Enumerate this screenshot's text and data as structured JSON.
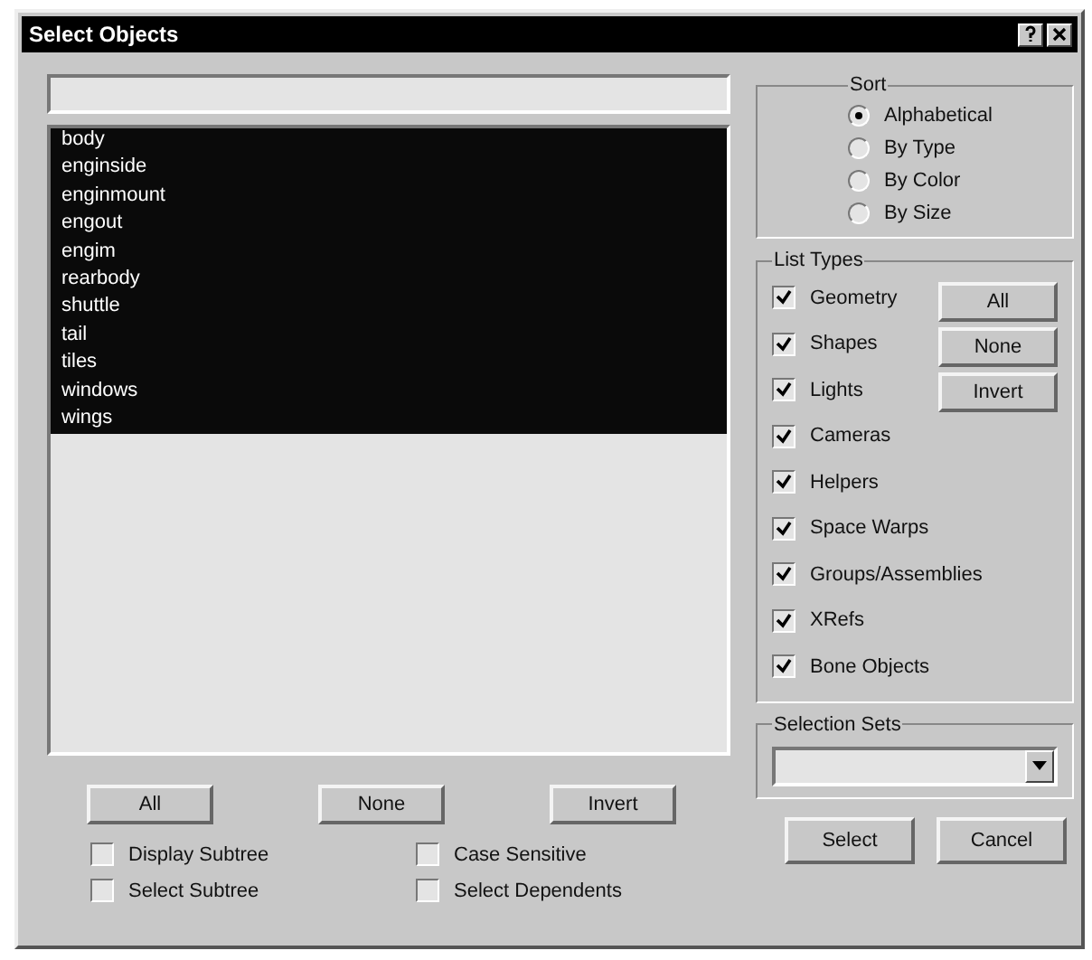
{
  "window": {
    "title": "Select Objects"
  },
  "objects": [
    {
      "name": "body",
      "selected": true
    },
    {
      "name": "enginside",
      "selected": true
    },
    {
      "name": "enginmount",
      "selected": true
    },
    {
      "name": "engout",
      "selected": true
    },
    {
      "name": "engim",
      "selected": true
    },
    {
      "name": "rearbody",
      "selected": true
    },
    {
      "name": "shuttle",
      "selected": true
    },
    {
      "name": "tail",
      "selected": true
    },
    {
      "name": "tiles",
      "selected": true
    },
    {
      "name": "windows",
      "selected": true
    },
    {
      "name": "wings",
      "selected": true
    }
  ],
  "list_buttons": [
    "All",
    "None",
    "Invert"
  ],
  "options": [
    {
      "label": "Display Subtree",
      "checked": false
    },
    {
      "label": "Case Sensitive",
      "checked": false
    },
    {
      "label": "Select Subtree",
      "checked": false
    },
    {
      "label": "Select Dependents",
      "checked": false
    }
  ],
  "sort": {
    "title": "Sort",
    "options": [
      {
        "label": "Alphabetical",
        "selected": true
      },
      {
        "label": "By Type",
        "selected": false
      },
      {
        "label": "By Color",
        "selected": false
      },
      {
        "label": "By Size",
        "selected": false
      }
    ]
  },
  "list_types": {
    "title": "List Types",
    "items": [
      {
        "label": "Geometry",
        "checked": true
      },
      {
        "label": "Shapes",
        "checked": true
      },
      {
        "label": "Lights",
        "checked": true
      },
      {
        "label": "Cameras",
        "checked": true
      },
      {
        "label": "Helpers",
        "checked": true
      },
      {
        "label": "Space Warps",
        "checked": true
      },
      {
        "label": "Groups/Assemblies",
        "checked": true
      },
      {
        "label": "XRefs",
        "checked": true
      },
      {
        "label": "Bone Objects",
        "checked": true
      }
    ],
    "buttons": [
      "All",
      "None",
      "Invert"
    ]
  },
  "selection_sets": {
    "title": "Selection Sets"
  },
  "buttons": [
    "Select",
    "Cancel"
  ]
}
